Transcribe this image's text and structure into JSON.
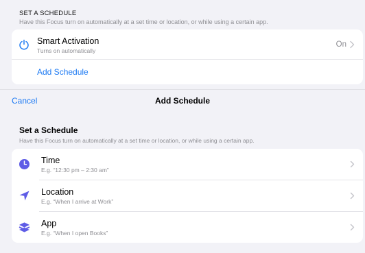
{
  "background": {
    "section_header": "SET A SCHEDULE",
    "section_subtitle": "Have this Focus turn on automatically at a set time or location, or while using a certain app.",
    "smart_activation": {
      "title": "Smart Activation",
      "subtitle": "Turns on automatically",
      "value": "On",
      "icon": "power-icon"
    },
    "add_schedule_label": "Add Schedule"
  },
  "sheet": {
    "cancel_label": "Cancel",
    "title": "Add Schedule",
    "section_title": "Set a Schedule",
    "section_subtitle": "Have this Focus turn on automatically at a set time or location, or while using a certain app.",
    "options": [
      {
        "title": "Time",
        "subtitle": "E.g. “12:30 pm – 2:30 am”",
        "icon": "clock-icon"
      },
      {
        "title": "Location",
        "subtitle": "E.g. “When I arrive at Work”",
        "icon": "location-arrow-icon"
      },
      {
        "title": "App",
        "subtitle": "E.g. “When I open Books”",
        "icon": "app-stack-icon"
      }
    ]
  },
  "colors": {
    "accent": "#1d7af3",
    "icon_purple": "#5e5ce6",
    "secondary_text": "#8e8e93",
    "background": "#f2f2f7"
  }
}
